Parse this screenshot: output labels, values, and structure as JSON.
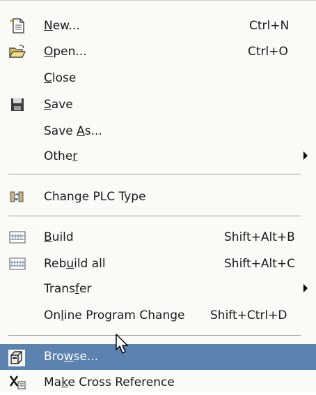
{
  "menu": {
    "new": {
      "before": "",
      "key": "N",
      "after": "ew...",
      "shortcut": "Ctrl+N",
      "icon": "new-file-icon"
    },
    "open": {
      "before": "",
      "key": "O",
      "after": "pen...",
      "shortcut": "Ctrl+O",
      "icon": "open-folder-icon"
    },
    "close": {
      "before": "",
      "key": "C",
      "after": "lose"
    },
    "save": {
      "before": "",
      "key": "S",
      "after": "ave",
      "icon": "floppy-disk-icon"
    },
    "save_as": {
      "before": "Save ",
      "key": "A",
      "after": "s..."
    },
    "other": {
      "before": "Othe",
      "key": "r",
      "after": ""
    },
    "change_plc": {
      "label": "Change PLC Type",
      "icon": "change-plc-icon"
    },
    "build": {
      "before": "",
      "key": "B",
      "after": "uild",
      "shortcut": "Shift+Alt+B",
      "icon": "build-icon"
    },
    "rebuild": {
      "before": "Reb",
      "key": "u",
      "after": "ild all",
      "shortcut": "Shift+Alt+C",
      "icon": "rebuild-icon"
    },
    "transfer": {
      "before": "Trans",
      "key": "f",
      "after": "er"
    },
    "online": {
      "before": "On",
      "key": "l",
      "after": "ine Program Change",
      "shortcut": "Shift+Ctrl+D"
    },
    "browse": {
      "before": "Bro",
      "key": "w",
      "after": "se...",
      "icon": "browse-icon"
    },
    "cross_ref": {
      "before": "Ma",
      "key": "k",
      "after": "e Cross Reference",
      "icon": "cross-reference-icon"
    }
  },
  "colors": {
    "highlight": "#5c82b0",
    "background": "#fafaf7"
  }
}
